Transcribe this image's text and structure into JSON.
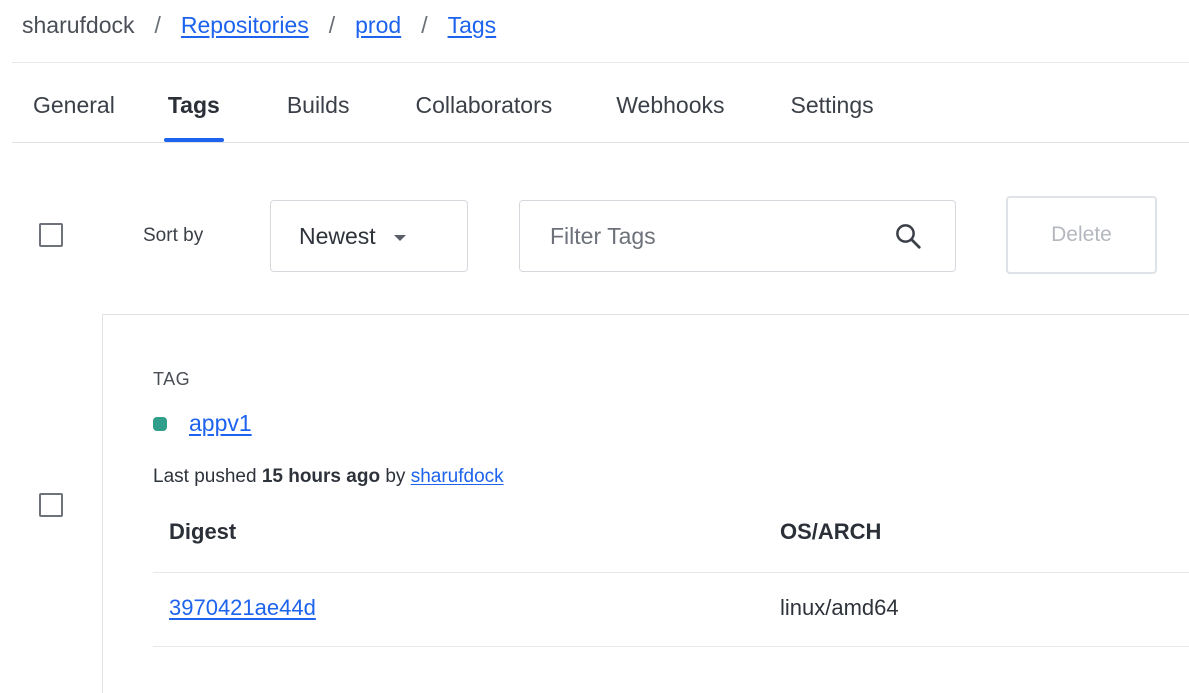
{
  "breadcrumb": {
    "owner": "sharufdock",
    "separator": "/",
    "items": [
      "Repositories",
      "prod",
      "Tags"
    ]
  },
  "tabs": [
    {
      "label": "General",
      "active": false
    },
    {
      "label": "Tags",
      "active": true
    },
    {
      "label": "Builds",
      "active": false
    },
    {
      "label": "Collaborators",
      "active": false
    },
    {
      "label": "Webhooks",
      "active": false
    },
    {
      "label": "Settings",
      "active": false
    }
  ],
  "toolbar": {
    "sort_label": "Sort by",
    "sort_value": "Newest",
    "filter_placeholder": "Filter Tags",
    "delete_label": "Delete"
  },
  "tag": {
    "header": "TAG",
    "name": "appv1",
    "status_color": "#2f9e8a",
    "pushed_prefix": "Last pushed",
    "pushed_time": "15 hours ago",
    "pushed_by_prefix": "by",
    "pushed_by": "sharufdock",
    "table": {
      "columns": [
        "Digest",
        "OS/ARCH"
      ],
      "rows": [
        {
          "digest": "3970421ae44d",
          "os_arch": "linux/amd64"
        }
      ]
    }
  },
  "colors": {
    "accent": "#1d63ed"
  }
}
